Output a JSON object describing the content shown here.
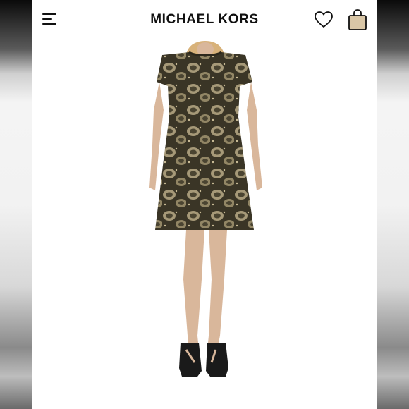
{
  "header": {
    "brand": "MICHAEL KORS",
    "menu_icon": "menu-icon",
    "favorites_icon": "heart-icon",
    "bag_icon": "shopping-bag-icon"
  },
  "product_image": {
    "subject": "snake-print-dress",
    "colors": {
      "dress_base": "#3a3526",
      "dress_pattern": "#b9ab86",
      "skin": "#d9b79b",
      "hair": "#d8b27a",
      "shoes": "#1a1a1a",
      "bag_icon_fill": "#d9c6a6"
    }
  }
}
